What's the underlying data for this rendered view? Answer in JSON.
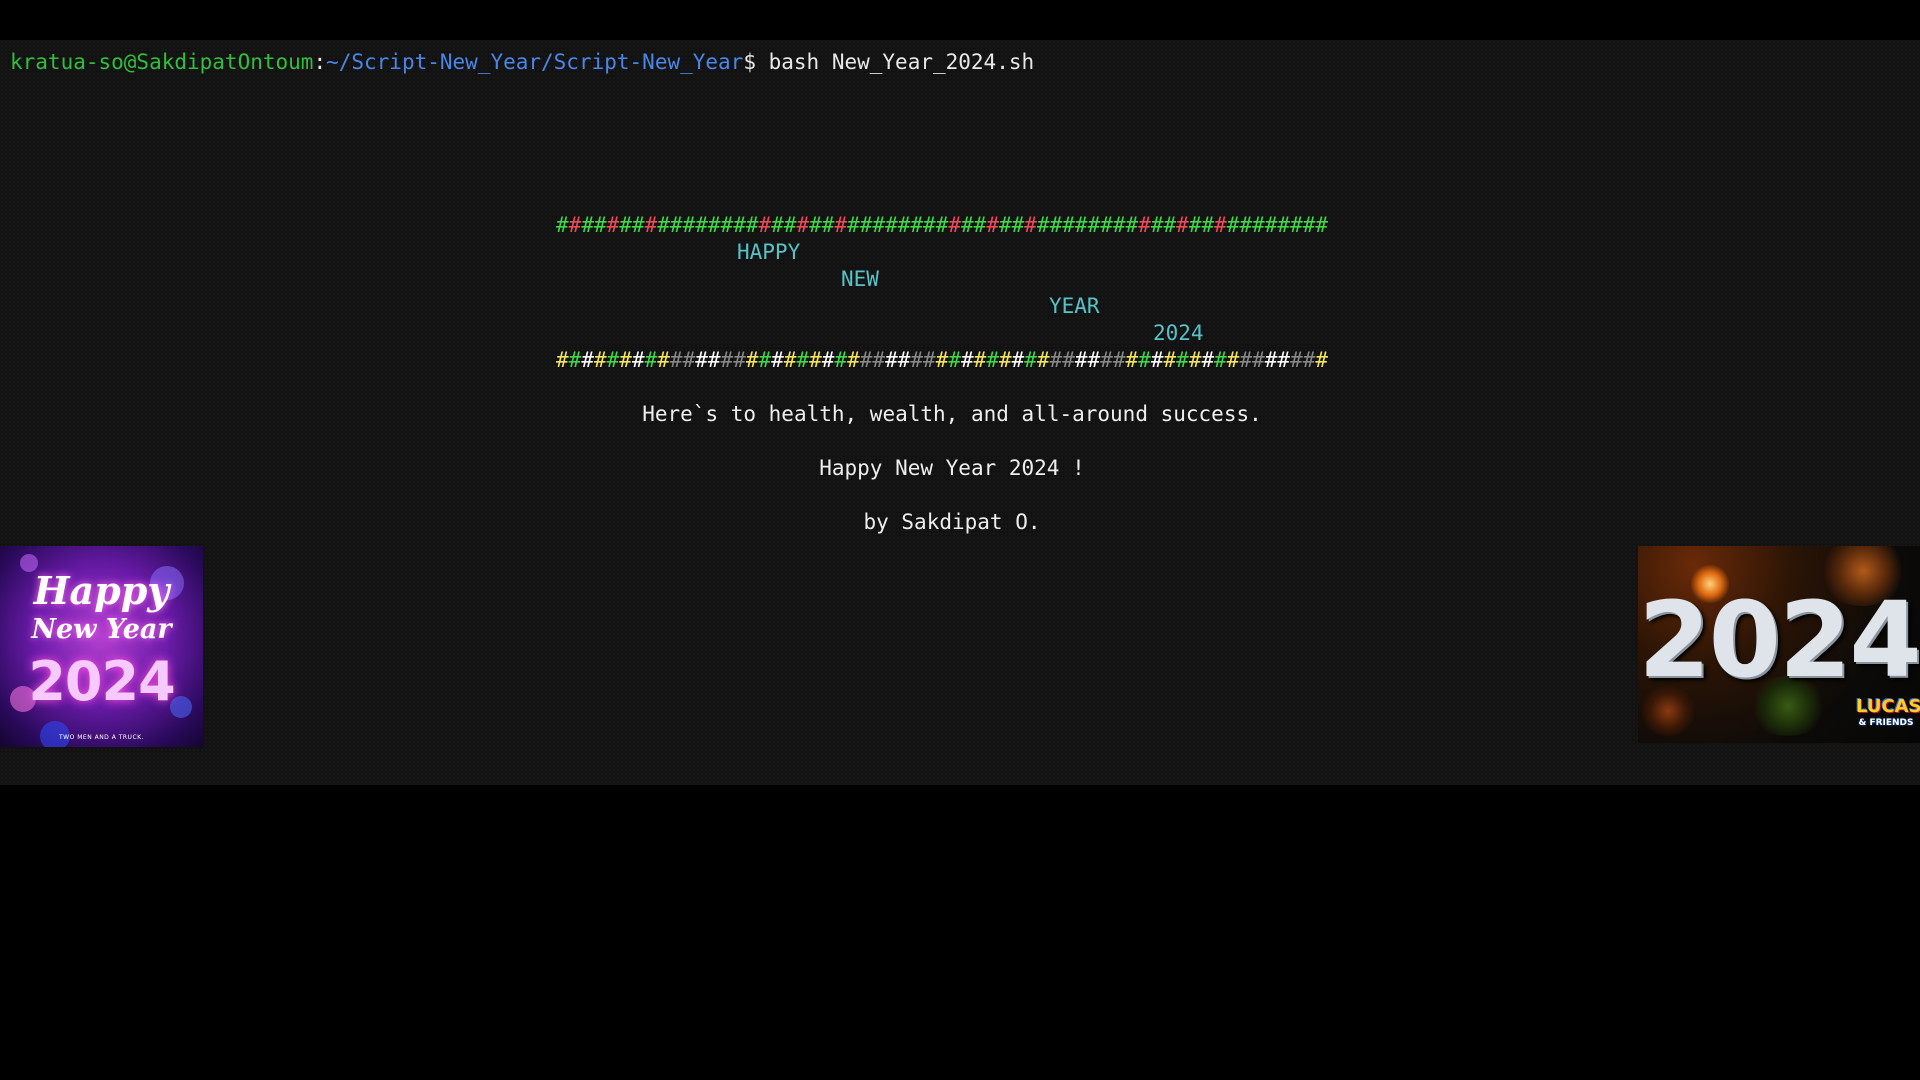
{
  "prompt": {
    "user_host": "kratua-so@SakdipatOntoum",
    "separator": ":",
    "path": "~/Script-New_Year/Script-New_Year",
    "dollar": "$",
    "command": " bash New_Year_2024.sh"
  },
  "banner": {
    "hash_char": "#",
    "hash_count": 61,
    "palette": [
      "#3fd84a",
      "#f5e55b",
      "#ffffff",
      "#3fd84a",
      "#ffffff",
      "#3fd84a",
      "#888888",
      "#c03ad0",
      "#f04a5a",
      "#3fd84a",
      "#888888",
      "#ffffff",
      "#4a86e8",
      "#57c3c8",
      "#f04a5a"
    ],
    "words": [
      "HAPPY",
      "NEW",
      "YEAR",
      "2024"
    ],
    "word_color": "#57c3c8"
  },
  "messages": {
    "line1": "Here`s to health, wealth, and all-around success.",
    "line2": "Happy New Year 2024 !",
    "line3": "by Sakdipat O."
  },
  "card_left": {
    "title": "Happy",
    "subtitle": "New Year",
    "year": "2024",
    "caption": "TWO MEN AND A TRUCK."
  },
  "card_right": {
    "year": "2024",
    "logo_main": "LUCAS",
    "logo_sub": "& FRIENDS"
  }
}
